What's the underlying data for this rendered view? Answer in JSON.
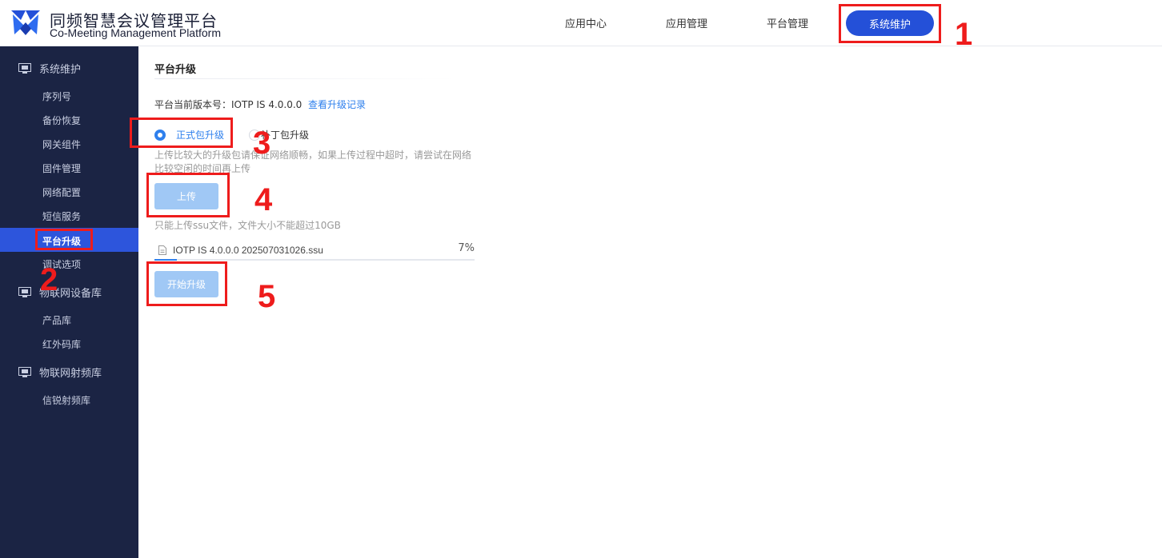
{
  "app": {
    "title_cn": "同频智慧会议管理平台",
    "title_en": "Co-Meeting Management Platform"
  },
  "topnav": {
    "items": [
      "应用中心",
      "应用管理",
      "平台管理"
    ],
    "active": "系统维护"
  },
  "sidebar": {
    "groups": [
      {
        "label": "系统维护",
        "icon": "monitor-icon",
        "items": [
          "序列号",
          "备份恢复",
          "网关组件",
          "固件管理",
          "网络配置",
          "短信服务",
          "平台升级",
          "调试选项"
        ]
      },
      {
        "label": "物联网设备库",
        "icon": "monitor-icon",
        "items": [
          "产品库",
          "红外码库"
        ]
      },
      {
        "label": "物联网射频库",
        "icon": "monitor-icon",
        "items": [
          "信锐射频库"
        ]
      }
    ],
    "active_item": "平台升级"
  },
  "main": {
    "title": "平台升级",
    "version_label": "平台当前版本号：IOTP IS 4.0.0.0",
    "version_link": "查看升级记录",
    "radio_formal": "正式包升级",
    "radio_patch": "补丁包升级",
    "hint": "上传比较大的升级包请保证网络顺畅，如果上传过程中超时，请尝试在网络比较空闲的时间再上传",
    "upload_button": "上传",
    "upload_note": "只能上传ssu文件，文件大小不能超过10GB",
    "file_name": "IOTP IS 4.0.0.0 202507031026.ssu",
    "progress_text": "7%",
    "progress_value": 0.07,
    "start_button": "开始升级"
  },
  "annotations": [
    "1",
    "2",
    "3",
    "4",
    "5"
  ],
  "colors": {
    "sidebar_bg": "#1b2444",
    "active_blue": "#2450d8",
    "link_blue": "#2f80ed",
    "disabled_button": "#a0c8f5",
    "annotation_red": "#ee1c1c"
  }
}
